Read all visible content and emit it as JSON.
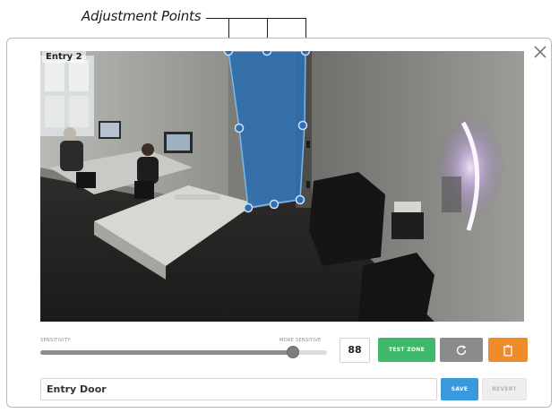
{
  "callout": {
    "text": "Adjustment Points"
  },
  "camera": {
    "label": "Entry 2"
  },
  "sensitivity": {
    "label_left": "SENSITIVITY",
    "label_right": "MORE SENSITIVE",
    "value": "88",
    "level_fraction": 0.88
  },
  "buttons": {
    "test_zone": "TEST ZONE",
    "refresh_icon": "refresh-icon",
    "delete_icon": "trash-icon",
    "save": "SAVE",
    "revert": "REVERT"
  },
  "zone_name": {
    "value": "Entry Door"
  },
  "colors": {
    "zone_fill": "#2f6fb0",
    "zone_stroke": "#7fb6e8",
    "test_zone": "#3fb86a",
    "refresh": "#8b8b8b",
    "delete": "#f08b2c",
    "save": "#3a98dc"
  }
}
